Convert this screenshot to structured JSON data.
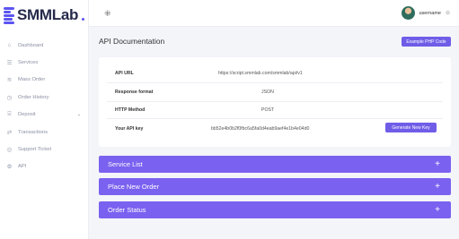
{
  "brand": {
    "name": "SMMLab"
  },
  "sidebar": {
    "items": [
      {
        "label": "Dashboard",
        "icon": "home-icon"
      },
      {
        "label": "Services",
        "icon": "list-icon"
      },
      {
        "label": "Mass Order",
        "icon": "layers-icon"
      },
      {
        "label": "Order History",
        "icon": "clock-icon"
      },
      {
        "label": "Deposit",
        "icon": "bank-icon"
      },
      {
        "label": "Transactions",
        "icon": "exchange-icon"
      },
      {
        "label": "Support Ticket",
        "icon": "support-icon"
      },
      {
        "label": "API",
        "icon": "code-icon"
      }
    ]
  },
  "topbar": {
    "username": "username",
    "menu_glyph": "⁜",
    "caret": "⊖"
  },
  "page": {
    "title": "API Documentation",
    "example_button": "Example PHP Code"
  },
  "api": {
    "url_label": "API URL",
    "url_value": "https://script.smmlab.com/smmlab/api/v1",
    "format_label": "Response format",
    "format_value": "JSON",
    "method_label": "HTTP Method",
    "method_value": "POST",
    "key_label": "Your API key",
    "key_value": "bb52e4b0b2f0fbc6a5fa0d4eab9aef4e1b4e04d0",
    "generate_button": "Generate New Key"
  },
  "accordions": [
    {
      "label": "Service List",
      "icon": "+"
    },
    {
      "label": "Place New Order",
      "icon": "+"
    },
    {
      "label": "Order Status",
      "icon": "+"
    }
  ],
  "colors": {
    "accent": "#6f5de8",
    "accordion": "#7b61f0",
    "sidebar_bg": "#ffffff",
    "page_bg": "#f4f5f9"
  }
}
